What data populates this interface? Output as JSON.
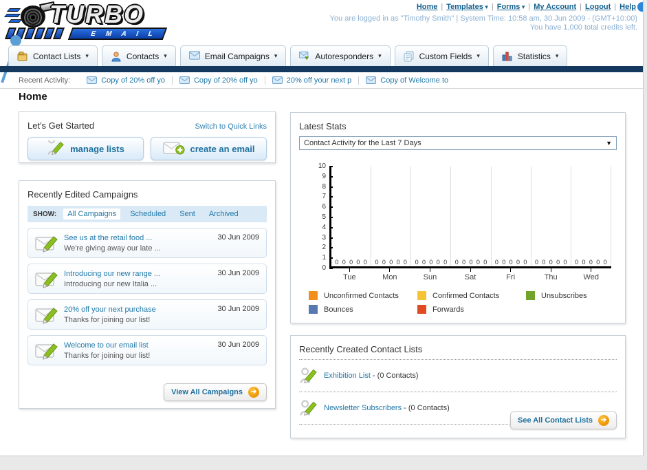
{
  "logo": {
    "title": "TURBO",
    "subtitle": "E M A I L"
  },
  "header": {
    "links": [
      {
        "label": "Home",
        "dropdown": false
      },
      {
        "label": "Templates",
        "dropdown": true
      },
      {
        "label": "Forms",
        "dropdown": true
      },
      {
        "label": "My Account",
        "dropdown": false
      },
      {
        "label": "Logout",
        "dropdown": false
      },
      {
        "label": "Help",
        "dropdown": false
      }
    ],
    "separator": "|",
    "status_line1": "You are logged in as \"Timothy Smith\" | System Time: 10:58 am, 30 Jun 2009 - (GMT+10:00)",
    "status_line2": "You have 1,000 total credits left."
  },
  "nav_tabs": [
    {
      "label": "Contact Lists",
      "icon": "contact-lists"
    },
    {
      "label": "Contacts",
      "icon": "contacts"
    },
    {
      "label": "Email Campaigns",
      "icon": "email-campaigns"
    },
    {
      "label": "Autoresponders",
      "icon": "autoresponders"
    },
    {
      "label": "Custom Fields",
      "icon": "custom-fields"
    },
    {
      "label": "Statistics",
      "icon": "statistics"
    }
  ],
  "recent_activity": {
    "label": "Recent Activity:",
    "items": [
      "Copy of 20% off yo",
      "Copy of 20% off yo",
      "20% off your next p",
      "Copy of Welcome to"
    ]
  },
  "main": {
    "title": "Home"
  },
  "get_started": {
    "title": "Let's Get Started",
    "switch_link": "Switch to Quick Links",
    "buttons": [
      {
        "label": "manage lists",
        "icon": "pencil-list"
      },
      {
        "label": "create an email",
        "icon": "envelope-plus"
      }
    ]
  },
  "campaigns": {
    "title": "Recently Edited Campaigns",
    "show_label": "SHOW:",
    "filters": [
      {
        "label": "All Campaigns",
        "active": true
      },
      {
        "label": "Scheduled",
        "active": false
      },
      {
        "label": "Sent",
        "active": false
      },
      {
        "label": "Archived",
        "active": false
      }
    ],
    "items": [
      {
        "title": "See us at the retail food ...",
        "subtitle": "We're giving away our late ...",
        "date": "30 Jun 2009"
      },
      {
        "title": "Introducing our new range ...",
        "subtitle": "Introducing our new Italia ...",
        "date": "30 Jun 2009"
      },
      {
        "title": "20% off your next purchase",
        "subtitle": "Thanks for joining our list!",
        "date": "30 Jun 2009"
      },
      {
        "title": "Welcome to our email list",
        "subtitle": "Thanks for joining our list!",
        "date": "30 Jun 2009"
      }
    ],
    "view_all": "View All Campaigns"
  },
  "stats": {
    "title": "Latest Stats",
    "dropdown_value": "Contact Activity for the Last 7 Days"
  },
  "chart_data": {
    "type": "bar",
    "title": "Contact Activity for the Last 7 Days",
    "categories": [
      "Tue",
      "Mon",
      "Sun",
      "Sat",
      "Fri",
      "Thu",
      "Wed"
    ],
    "series": [
      {
        "name": "Unconfirmed Contacts",
        "color": "#F28E1E",
        "values": [
          0,
          0,
          0,
          0,
          0,
          0,
          0
        ]
      },
      {
        "name": "Confirmed Contacts",
        "color": "#F5C432",
        "values": [
          0,
          0,
          0,
          0,
          0,
          0,
          0
        ]
      },
      {
        "name": "Unsubscribes",
        "color": "#74A32C",
        "values": [
          0,
          0,
          0,
          0,
          0,
          0,
          0
        ]
      },
      {
        "name": "Bounces",
        "color": "#5878B4",
        "values": [
          0,
          0,
          0,
          0,
          0,
          0,
          0
        ]
      },
      {
        "name": "Forwards",
        "color": "#E14B23",
        "values": [
          0,
          0,
          0,
          0,
          0,
          0,
          0
        ]
      }
    ],
    "xlabel": "",
    "ylabel": "",
    "ylim": [
      0,
      10
    ],
    "yticks": [
      0,
      1,
      2,
      3,
      4,
      5,
      6,
      7,
      8,
      9,
      10
    ],
    "grid": "vertical between day groups",
    "legend_position": "bottom",
    "data_labels": "each bar labeled 0 at baseline"
  },
  "contact_lists": {
    "title": "Recently Created Contact Lists",
    "items": [
      {
        "name": "Exhibition List",
        "suffix": " - (0 Contacts)"
      },
      {
        "name": "Newsletter Subscribers",
        "suffix": " - (0 Contacts)"
      }
    ],
    "see_all": "See All Contact Lists"
  },
  "colors": {
    "navy_bar": "#15395E",
    "link_blue": "#2179A8",
    "header_link_blue": "#16618F",
    "status_text_blue": "#8BB0D3",
    "arrow_orange": "#ED9405",
    "logo_blue": "#0B3FA8"
  }
}
